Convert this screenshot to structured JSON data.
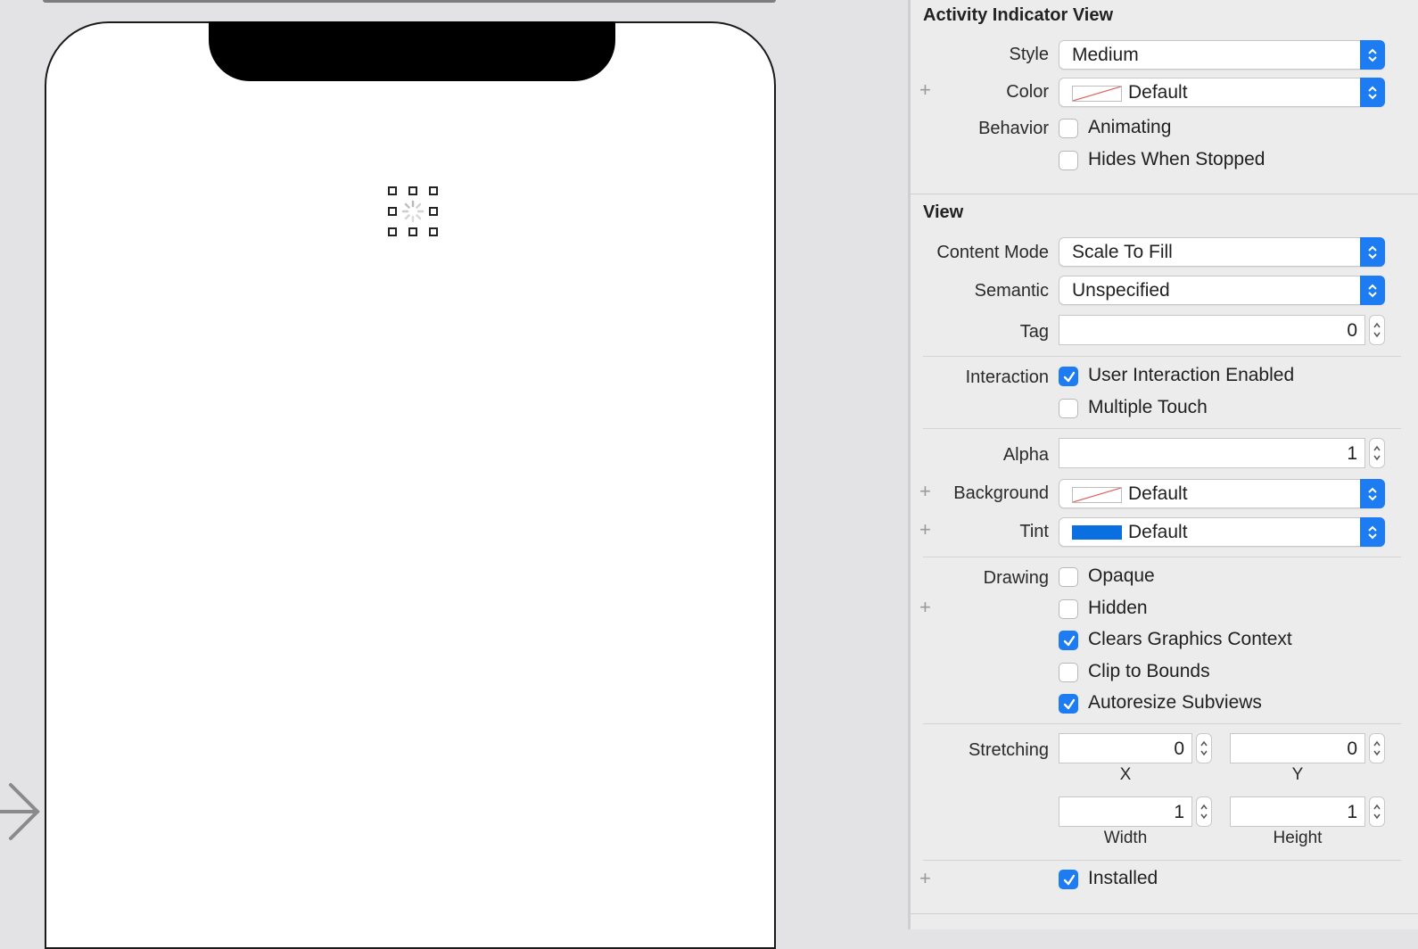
{
  "inspector": {
    "activity_section": {
      "title": "Activity Indicator View",
      "style": {
        "label": "Style",
        "value": "Medium"
      },
      "color": {
        "label": "Color",
        "value": "Default"
      },
      "behavior": {
        "label": "Behavior",
        "animating": {
          "label": "Animating",
          "checked": false
        },
        "hides_when_stopped": {
          "label": "Hides When Stopped",
          "checked": false
        }
      }
    },
    "view_section": {
      "title": "View",
      "content_mode": {
        "label": "Content Mode",
        "value": "Scale To Fill"
      },
      "semantic": {
        "label": "Semantic",
        "value": "Unspecified"
      },
      "tag": {
        "label": "Tag",
        "value": "0"
      },
      "interaction": {
        "label": "Interaction",
        "user_interaction_enabled": {
          "label": "User Interaction Enabled",
          "checked": true
        },
        "multiple_touch": {
          "label": "Multiple Touch",
          "checked": false
        }
      },
      "alpha": {
        "label": "Alpha",
        "value": "1"
      },
      "background": {
        "label": "Background",
        "value": "Default"
      },
      "tint": {
        "label": "Tint",
        "value": "Default",
        "swatch_color": "#0a6fe0"
      },
      "drawing": {
        "label": "Drawing",
        "opaque": {
          "label": "Opaque",
          "checked": false
        },
        "hidden": {
          "label": "Hidden",
          "checked": false
        },
        "clears_graphics_context": {
          "label": "Clears Graphics Context",
          "checked": true
        },
        "clip_to_bounds": {
          "label": "Clip to Bounds",
          "checked": false
        },
        "autoresize_subviews": {
          "label": "Autoresize Subviews",
          "checked": true
        }
      },
      "stretching": {
        "label": "Stretching",
        "x": {
          "label": "X",
          "value": "0"
        },
        "y": {
          "label": "Y",
          "value": "0"
        },
        "width": {
          "label": "Width",
          "value": "1"
        },
        "height": {
          "label": "Height",
          "value": "1"
        }
      },
      "installed": {
        "label": "Installed",
        "checked": true
      }
    }
  },
  "colors": {
    "accent": "#1d7cf2",
    "canvas_bg": "#e3e3e6",
    "inspector_bg": "#ececec"
  },
  "icons": [
    "plus-icon",
    "popup-arrows-icon",
    "stepper-icon",
    "checkmark-icon",
    "activity-indicator-icon",
    "entry-point-arrow-icon"
  ]
}
